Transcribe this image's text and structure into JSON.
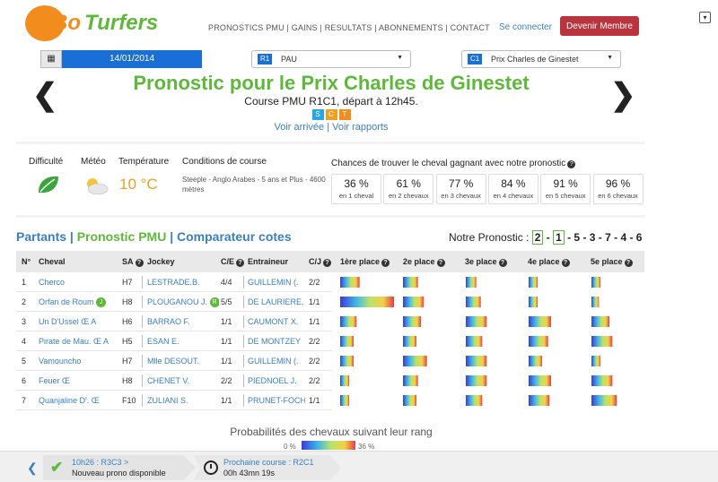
{
  "header": {
    "logo_bo": "Bo",
    "logo_turfers": "Turfers",
    "nav": "PRONOSTICS PMU | GAINS | RESULTATS | ABONNEMENTS | CONTACT",
    "login": "Se connecter",
    "member_button": "Devenir Membre",
    "corner_glyph": "▾"
  },
  "selectors": {
    "date": "14/01/2014",
    "calendar_glyph": "▦",
    "reunion_tag": "R1",
    "reunion_label": "PAU",
    "course_tag": "C1",
    "course_label": "Prix Charles de Ginestet",
    "arrow_glyph": "▼"
  },
  "race": {
    "title": "Pronostic pour le Prix Charles de Ginestet",
    "subtitle": "Course PMU R1C1, départ à 12h45.",
    "badges": [
      "S",
      "C",
      "T"
    ],
    "link_arrivee": "Voir arrivée",
    "link_sep": " | ",
    "link_rapports": "Voir rapports",
    "prev_glyph": "❮",
    "next_glyph": "❯"
  },
  "info": {
    "difficulty_label": "Difficulté",
    "weather_label": "Météo",
    "temperature_label": "Température",
    "temperature_value": "10 °C",
    "conditions_label": "Conditions de course",
    "conditions_value": "Steeple - Anglo Arabes - 5 ans et Plus - 4600 mètres",
    "difficulty_icon": "leaf-icon",
    "weather_icon": "sun-cloud-icon",
    "leaf_color": "#3aa53a"
  },
  "chances": {
    "title": "Chances de trouver le cheval gagnant avec notre pronostic",
    "items": [
      {
        "pct": "36 %",
        "label": "en 1 cheval"
      },
      {
        "pct": "61 %",
        "label": "en 2 chevaux"
      },
      {
        "pct": "77 %",
        "label": "en 3 chevaux"
      },
      {
        "pct": "84 %",
        "label": "en 4 chevaux"
      },
      {
        "pct": "91 %",
        "label": "en 5 chevaux"
      },
      {
        "pct": "96 %",
        "label": "en 6 chevaux"
      }
    ]
  },
  "tabs": {
    "partants": "Partants",
    "sep1": " | ",
    "prono": "Pronostic PMU",
    "sep2": " | ",
    "comparateur": "Comparateur cotes"
  },
  "pronostic": {
    "label": "Notre Pronostic :",
    "first": "2",
    "dash1": " - ",
    "second": "1",
    "rest": " - 5 - 3 - 7 - 4 - 6"
  },
  "table": {
    "headers": {
      "num": "N°",
      "cheval": "Cheval",
      "sa": "SA",
      "jockey": "Jockey",
      "ce": "C/E",
      "entraineur": "Entraineur",
      "cj": "C/J",
      "place1": "1ère place",
      "place2": "2e place",
      "place3": "3e place",
      "place4": "4e place",
      "place5": "5e place"
    },
    "help_glyph": "?",
    "rows": [
      {
        "num": "1",
        "cheval": "Cherco",
        "badge": "",
        "sa": "H7",
        "jockey": "LESTRADE.B.",
        "jbadge": "",
        "ce": "4/4",
        "entraineur": "GUILLEMIN (.",
        "cj": "2/2"
      },
      {
        "num": "2",
        "cheval": "Orfan de Roum",
        "badge": "J",
        "sa": "H8",
        "jockey": "PLOUGANOU J.",
        "jbadge": "R",
        "ce": "5/5",
        "entraineur": "DE LAURIERE.",
        "cj": "1/1"
      },
      {
        "num": "3",
        "cheval": "Un D'Ussel Œ A",
        "badge": "",
        "sa": "H6",
        "jockey": "BARRAO F.",
        "jbadge": "",
        "ce": "1/1",
        "entraineur": "CAUMONT X.",
        "cj": "1/1"
      },
      {
        "num": "4",
        "cheval": "Pirate de Mau. Œ A",
        "badge": "",
        "sa": "H5",
        "jockey": "ESAN E.",
        "jbadge": "",
        "ce": "1/1",
        "entraineur": "DE MONTZEY",
        "cj": "2/2"
      },
      {
        "num": "5",
        "cheval": "Vamouncho",
        "badge": "",
        "sa": "H7",
        "jockey": "Mlle DESOUT.",
        "jbadge": "",
        "ce": "1/1",
        "entraineur": "GUILLEMIN (.",
        "cj": "2/2"
      },
      {
        "num": "6",
        "cheval": "Feuer Œ",
        "badge": "",
        "sa": "H8",
        "jockey": "CHENET V.",
        "jbadge": "",
        "ce": "2/2",
        "entraineur": "PIEDNOEL J.",
        "cj": "2/2"
      },
      {
        "num": "7",
        "cheval": "Quanjaline D'. Œ",
        "badge": "",
        "sa": "F10",
        "jockey": "ZULIANI S.",
        "jbadge": "",
        "ce": "1/1",
        "entraineur": "PRUNET-FOCH.",
        "cj": "1/1"
      }
    ]
  },
  "probabilities": {
    "max_pct": 36,
    "rows": [
      [
        13,
        10,
        7,
        6,
        6
      ],
      [
        36,
        14,
        10,
        6,
        5
      ],
      [
        11,
        12,
        14,
        15,
        12
      ],
      [
        9,
        9,
        11,
        13,
        14
      ],
      [
        9,
        16,
        14,
        9,
        6
      ],
      [
        6,
        10,
        14,
        15,
        14
      ],
      [
        6,
        9,
        11,
        14,
        17
      ]
    ]
  },
  "legend": {
    "title": "Probabilités des chevaux suivant leur rang",
    "min": "0 %",
    "max": "36 %"
  },
  "footer": {
    "back_glyph": "❮",
    "card1_line1": "10h26 : R3C3 >",
    "card1_line2": "Nouveau prono disponible",
    "check_glyph": "✔",
    "card2_line1": "Prochaine course : R2C1",
    "card2_line2": "00h 43mn 19s"
  }
}
